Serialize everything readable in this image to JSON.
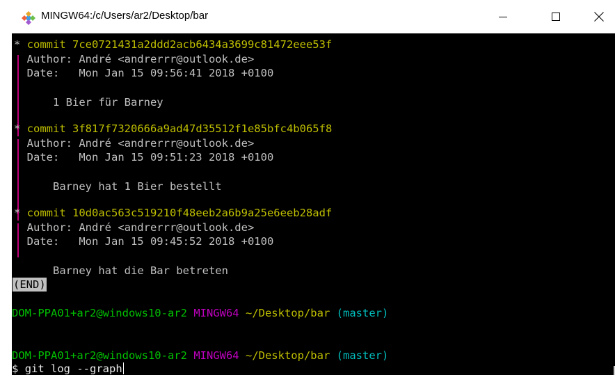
{
  "window": {
    "title": "MINGW64:/c/Users/ar2/Desktop/bar",
    "icon": "git-diamond-icon",
    "controls": {
      "minimize": "—",
      "maximize": "☐",
      "close": "✕"
    }
  },
  "terminal": {
    "commits": [
      {
        "star": "*",
        "commit_line": "commit 7ce0721431a2ddd2acb6434a3699c81472eee53f",
        "author_line": "Author: André <andrerrr@outlook.de>",
        "date_line": "Date:   Mon Jan 15 09:56:41 2018 +0100",
        "message": "1 Bier für Barney"
      },
      {
        "star": "*",
        "commit_line": "commit 3f817f7320666a9ad47d35512f1e85bfc4b065f8",
        "author_line": "Author: André <andrerrr@outlook.de>",
        "date_line": "Date:   Mon Jan 15 09:51:23 2018 +0100",
        "message": "Barney hat 1 Bier bestellt"
      },
      {
        "star": "*",
        "commit_line": "commit 10d0ac563c519210f48eeb2a6b9a25e6eeb28adf",
        "author_line": "Author: André <andrerrr@outlook.de>",
        "date_line": "Date:   Mon Jan 15 09:45:52 2018 +0100",
        "message": "Barney hat die Bar betreten"
      }
    ],
    "end_marker": "(END)",
    "prompt1": {
      "user_host": "DOM-PPA01+ar2@windows10-ar2",
      "system": "MINGW64",
      "path": "~/Desktop/bar",
      "branch": "(master)"
    },
    "prompt2": {
      "user_host": "DOM-PPA01+ar2@windows10-ar2",
      "system": "MINGW64",
      "path": "~/Desktop/bar",
      "branch": "(master)"
    },
    "input": {
      "symbol": "$",
      "command": "git log --graph"
    }
  },
  "colors": {
    "commit": "#bfbf00",
    "graph": "#c0007a",
    "prompt_user": "#00bf00",
    "prompt_system": "#bf00bf",
    "prompt_path": "#bfbf00",
    "prompt_branch": "#00bfbf",
    "background": "#000000",
    "text": "#c0c0c0"
  }
}
